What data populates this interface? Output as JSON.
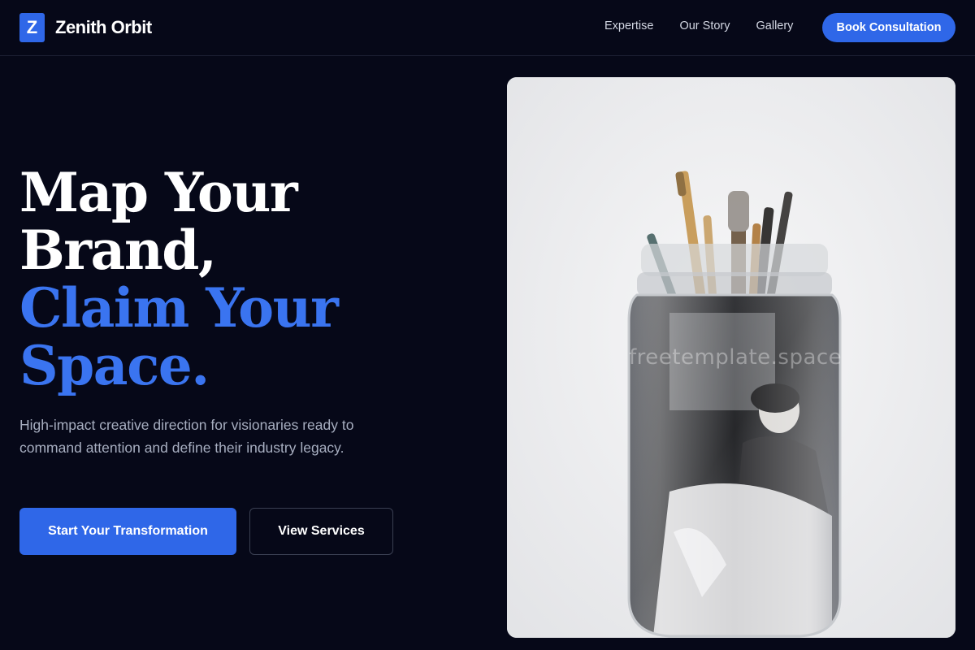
{
  "brand": {
    "logo_letter": "Z",
    "name": "Zenith Orbit"
  },
  "nav": {
    "links": [
      {
        "label": "Expertise"
      },
      {
        "label": "Our Story"
      },
      {
        "label": "Gallery"
      }
    ],
    "cta_label": "Book Consultation"
  },
  "hero": {
    "headline_lines": [
      {
        "text": "Map Your",
        "color": "#ffffff"
      },
      {
        "text": "Brand,",
        "color": "#ffffff"
      },
      {
        "text": "Claim Your",
        "color": "#3a74f0"
      },
      {
        "text": "Space.",
        "color": "#3a74f0"
      }
    ],
    "subtitle": "High-impact creative direction for visionaries ready to command attention and define their industry legacy.",
    "primary_cta": "Start Your Transformation",
    "secondary_cta": "View Services",
    "image_watermark": "freetemplate.space"
  },
  "colors": {
    "background": "#060818",
    "accent": "#2f67e8",
    "headline_accent": "#3a74f0"
  }
}
